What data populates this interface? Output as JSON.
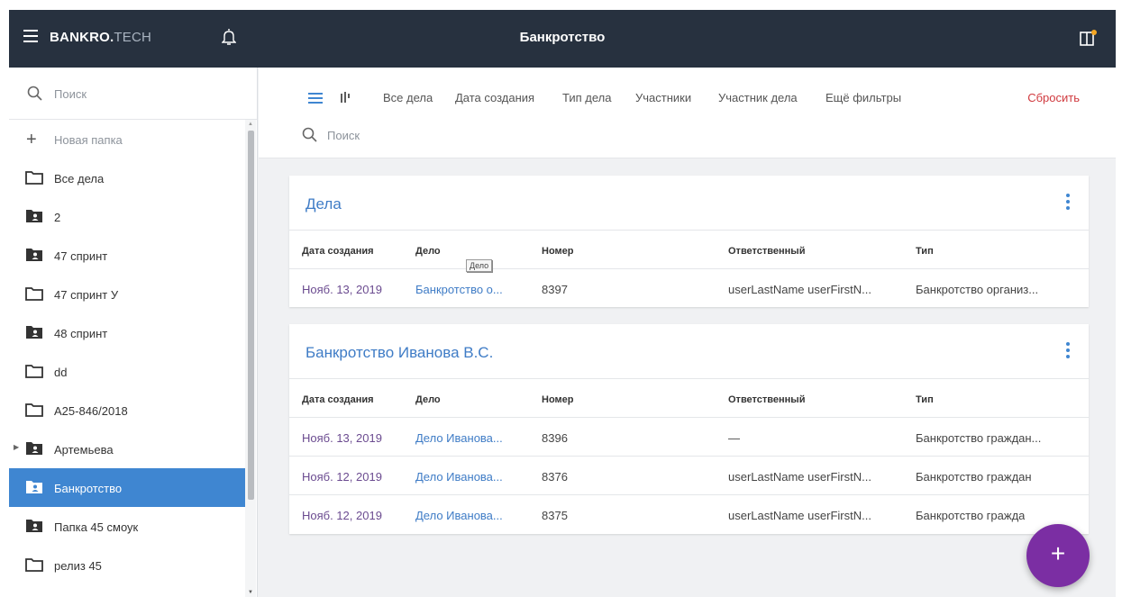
{
  "header": {
    "brand_bold": "BANKRO.",
    "brand_light": "TECH",
    "title": "Банкротство"
  },
  "sidebar": {
    "search_placeholder": "Поиск",
    "new_folder_label": "Новая папка",
    "items": [
      {
        "label": "Все дела",
        "icon": "folder-outline-icon"
      },
      {
        "label": "2",
        "icon": "shared-folder-icon"
      },
      {
        "label": "47 спринт",
        "icon": "shared-folder-icon"
      },
      {
        "label": "47 спринт У",
        "icon": "folder-outline-icon"
      },
      {
        "label": "48 спринт",
        "icon": "shared-folder-icon"
      },
      {
        "label": "dd",
        "icon": "folder-outline-icon"
      },
      {
        "label": "А25-846/2018",
        "icon": "folder-outline-icon"
      },
      {
        "label": "Артемьева",
        "icon": "shared-folder-icon"
      },
      {
        "label": "Банкротство",
        "icon": "shared-folder-icon",
        "active": true
      },
      {
        "label": "Папка 45 смоук",
        "icon": "shared-folder-icon"
      },
      {
        "label": "релиз 45",
        "icon": "folder-outline-icon"
      }
    ]
  },
  "filters": {
    "links": [
      "Все дела",
      "Дата создания",
      "Тип дела",
      "Участники",
      "Участник дела",
      "Ещё фильтры"
    ],
    "reset_label": "Сбросить",
    "search_placeholder": "Поиск"
  },
  "columns": [
    "Дата создания",
    "Дело",
    "Номер",
    "Ответственный",
    "Тип"
  ],
  "cards": [
    {
      "title": "Дела",
      "rows": [
        {
          "date": "Нояб. 13, 2019",
          "case": "Банкротство о...",
          "number": "8397",
          "responsible": "userLastName userFirstN...",
          "type": "Банкротство организ..."
        }
      ]
    },
    {
      "title": "Банкротство Иванова В.С.",
      "rows": [
        {
          "date": "Нояб. 13, 2019",
          "case": "Дело Иванова...",
          "number": "8396",
          "responsible": "—",
          "type": "Банкротство граждан..."
        },
        {
          "date": "Нояб. 12, 2019",
          "case": "Дело Иванова...",
          "number": "8376",
          "responsible": "userLastName userFirstN...",
          "type": "Банкротство граждан"
        },
        {
          "date": "Нояб. 12, 2019",
          "case": "Дело Иванова...",
          "number": "8375",
          "responsible": "userLastName userFirstN...",
          "type": "Банкротство гражда"
        }
      ]
    }
  ],
  "tooltip": "Дело",
  "fab_label": "+",
  "colors": {
    "topbar": "#27313f",
    "accent": "#3f86d1",
    "fab": "#7b2ea3",
    "reset": "#d0393e"
  }
}
